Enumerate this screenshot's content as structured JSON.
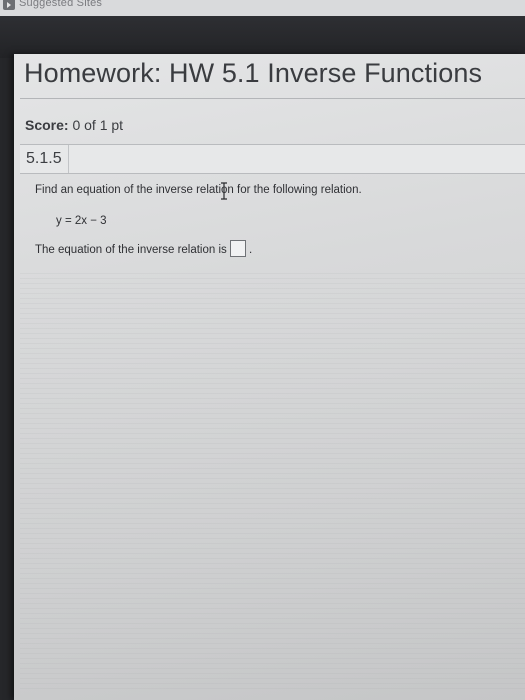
{
  "browser": {
    "bookmark_label": "Suggested Sites",
    "bookmark_icon": "bookmark-arrow-icon"
  },
  "homework": {
    "title": "Homework: HW 5.1 Inverse Functions",
    "score_label": "Score:",
    "score_value": "0 of 1 pt"
  },
  "question": {
    "id": "5.1.5",
    "prompt": "Find an equation of the inverse relation for the following relation.",
    "equation": "y = 2x − 3",
    "answer_lead": "The equation of the inverse relation is",
    "answer_value": "",
    "answer_suffix": "."
  },
  "colors": {
    "page_bg": "#dcdddf",
    "text": "#2f3034",
    "frame_dark": "#222326"
  }
}
